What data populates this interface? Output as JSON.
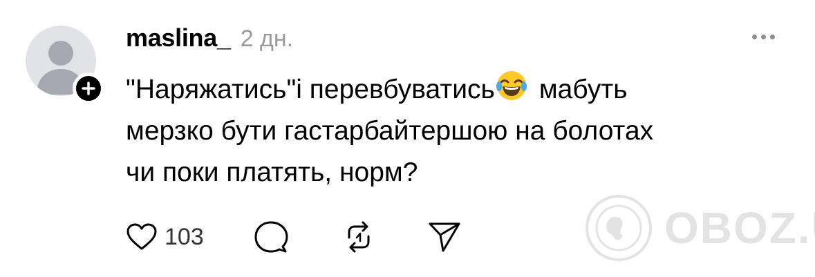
{
  "post": {
    "username": "maslina_",
    "time": "2 дн.",
    "text_lines": [
      "\"Наряжатись\"і перевбуватись",
      "мабуть",
      "мерзко бути гастарбайтершою на болотах",
      "чи поки платять, норм?"
    ],
    "emoji": "face-with-tears-of-joy",
    "like_count": "103"
  },
  "watermark": {
    "text": "OBOZ.UA"
  },
  "icons": {
    "avatar": "default-avatar-icon",
    "follow": "plus-icon",
    "more": "more-horizontal-icon",
    "like": "heart-icon",
    "comment": "comment-icon",
    "repost": "repost-icon",
    "share": "send-icon"
  }
}
